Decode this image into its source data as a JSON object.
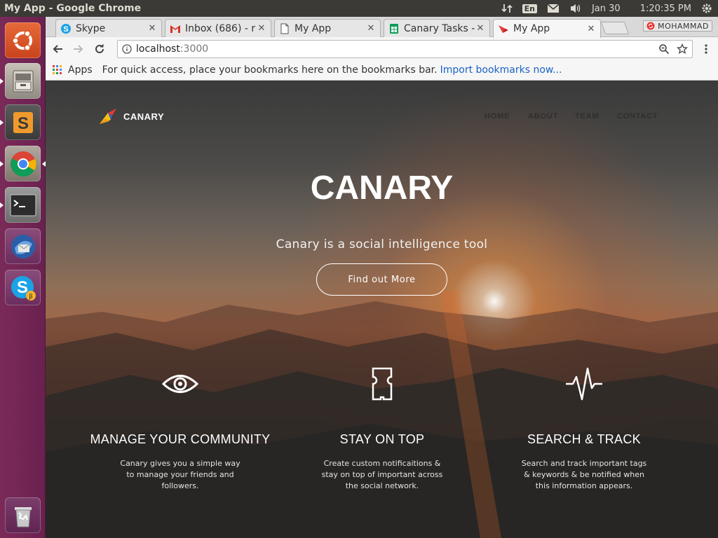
{
  "os": {
    "window_title": "My App - Google Chrome",
    "keyboard_layout": "En",
    "date": "Jan 30",
    "time": "1:20:35 PM"
  },
  "browser": {
    "tabs": [
      {
        "label": "Skype",
        "favicon": "skype-icon",
        "active": false
      },
      {
        "label": "Inbox (686) - r",
        "favicon": "gmail-icon",
        "active": false
      },
      {
        "label": "My App",
        "favicon": "page-icon",
        "active": false
      },
      {
        "label": "Canary Tasks -",
        "favicon": "sheets-icon",
        "active": false
      },
      {
        "label": "My App",
        "favicon": "app-icon",
        "active": true
      }
    ],
    "profile_name": "MOHAMMAD",
    "address": {
      "host": "localhost",
      "port": ":3000"
    },
    "bookmarks_bar": {
      "apps_label": "Apps",
      "hint": "For quick access, place your bookmarks here on the bookmarks bar.",
      "import_link": "Import bookmarks now..."
    }
  },
  "page": {
    "brand": "CANARY",
    "nav": [
      "HOME",
      "ABOUT",
      "TEAM",
      "CONTACT"
    ],
    "hero": {
      "title": "CANARY",
      "subtitle": "Canary is a social intelligence tool",
      "cta": "Find out More"
    },
    "features": [
      {
        "icon": "eye-icon",
        "title": "MANAGE YOUR COMMUNITY",
        "text": "Canary gives you a simple way to manage your friends and followers."
      },
      {
        "icon": "ticket-icon",
        "title": "STAY ON TOP",
        "text": "Create custom notificaitions & stay on top of important across the social network."
      },
      {
        "icon": "pulse-icon",
        "title": "SEARCH & TRACK",
        "text": "Search and track important tags & keywords & be notified when this information appears."
      }
    ]
  },
  "colors": {
    "launcher": "#7b2a58",
    "panel": "#3b3a36",
    "link_blue": "#1a62c6",
    "nav_text": "#2f2f2f"
  }
}
